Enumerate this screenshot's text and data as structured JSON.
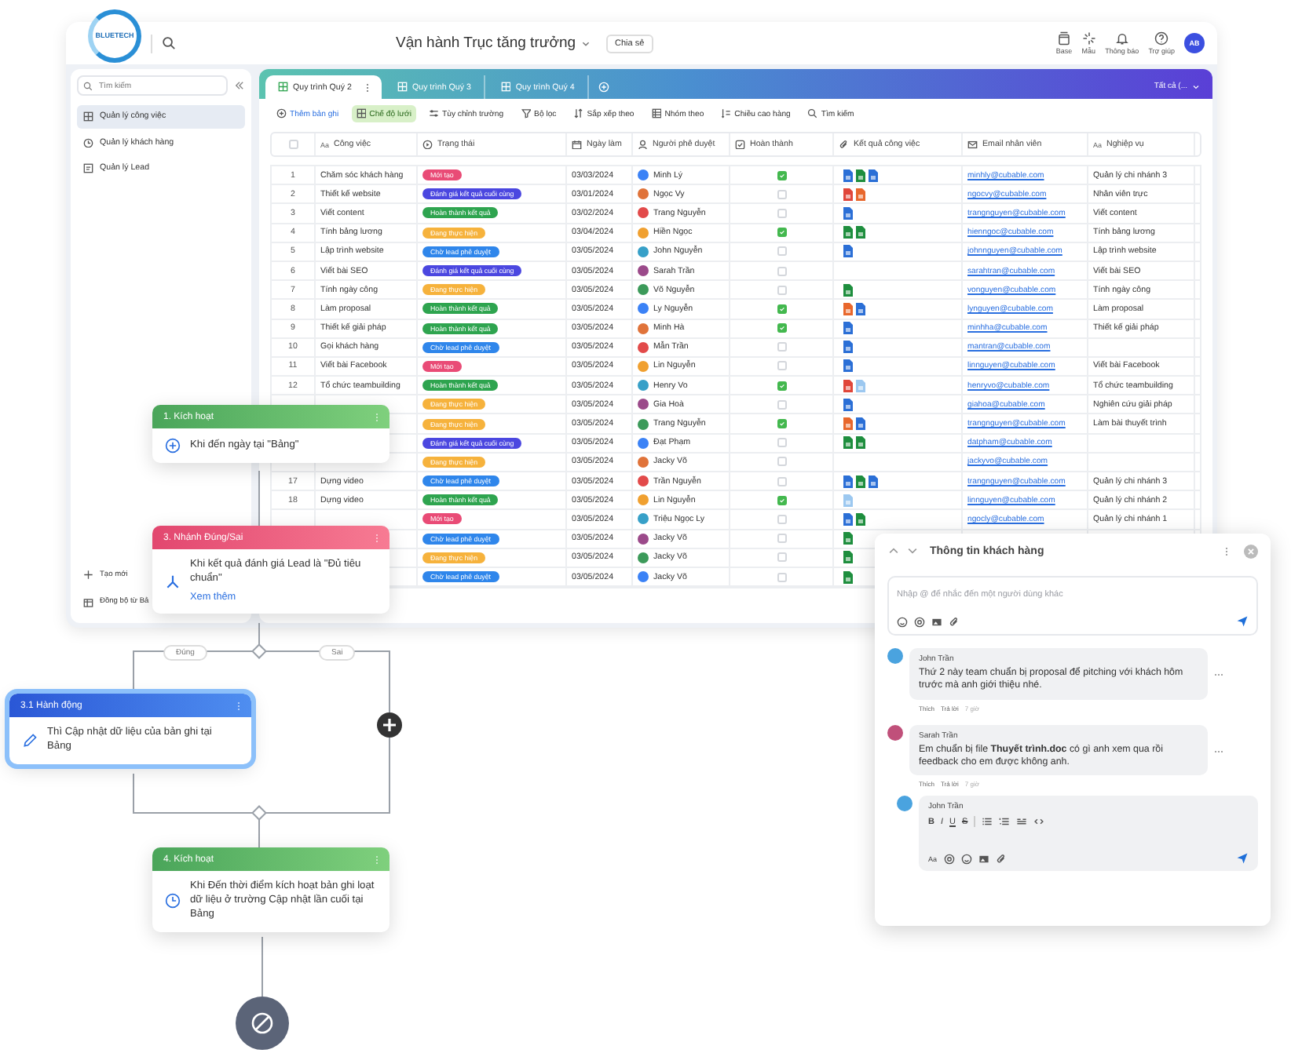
{
  "logo": {
    "text": "BLUETECH"
  },
  "header": {
    "title": "Vận hành Trục tăng trưởng",
    "share_button": "Chia sẻ",
    "actions": [
      {
        "label": "Base",
        "kind": "base"
      },
      {
        "label": "Mẫu",
        "kind": "template"
      },
      {
        "label": "Thông báo",
        "kind": "bell"
      },
      {
        "label": "Trợ giúp",
        "kind": "help"
      }
    ],
    "avatar": "AB"
  },
  "sidebar": {
    "search_placeholder": "Tìm kiếm",
    "items": [
      {
        "label": "Quản lý công việc",
        "kind": "grid",
        "selected": true
      },
      {
        "label": "Quản lý khách hàng",
        "kind": "clock",
        "selected": false
      },
      {
        "label": "Quản lý Lead",
        "kind": "form",
        "selected": false
      }
    ],
    "footer": [
      {
        "label": "Tạo mới",
        "kind": "plus"
      },
      {
        "label": "Đồng bộ từ Bả",
        "kind": "sync"
      }
    ]
  },
  "tabs": [
    {
      "label": "Quy trình Quý 2",
      "selected": true
    },
    {
      "label": "Quy trình Quý 3",
      "selected": false
    },
    {
      "label": "Quy trình Quý 4",
      "selected": false
    }
  ],
  "view_filter": "Tất cả (...",
  "toolbar": [
    {
      "label": "Thêm bản ghi",
      "kind": "add",
      "selected": false
    },
    {
      "label": "Chế độ lưới",
      "kind": "grid",
      "selected": true
    },
    {
      "label": "Tùy chỉnh trường",
      "kind": "fields",
      "selected": false
    },
    {
      "label": "Bộ lọc",
      "kind": "filter",
      "selected": false
    },
    {
      "label": "Sắp xếp theo",
      "kind": "sort",
      "selected": false
    },
    {
      "label": "Nhóm theo",
      "kind": "group",
      "selected": false
    },
    {
      "label": "Chiều cao hàng",
      "kind": "height",
      "selected": false
    },
    {
      "label": "Tìm kiếm",
      "kind": "search",
      "selected": false
    }
  ],
  "table": {
    "select_all_checked": false,
    "columns": [
      {
        "kind": "text",
        "icon_text": "Aa",
        "label": "Công việc"
      },
      {
        "kind": "status",
        "label": "Trạng thái"
      },
      {
        "kind": "date",
        "label": "Ngày làm"
      },
      {
        "kind": "person",
        "label": "Người phê duyệt"
      },
      {
        "kind": "check",
        "label": "Hoàn thành"
      },
      {
        "kind": "attach",
        "label": "Kết quả công việc"
      },
      {
        "kind": "email",
        "label": "Email nhân viên"
      },
      {
        "kind": "text",
        "icon_text": "Aa",
        "label": "Nghiệp vụ"
      }
    ],
    "rows": [
      {
        "number": "1",
        "task": "Chăm sóc khách hàng",
        "status": {
          "label": "Mới tạo",
          "color": "#e94b76"
        },
        "date": "03/03/2024",
        "approver": "Minh Lý",
        "done": true,
        "files": [
          {
            "kind": "doc"
          },
          {
            "kind": "sheet"
          },
          {
            "kind": "doc"
          }
        ],
        "email": "minhly@cubable.com",
        "role": "Quản lý chi nhánh 3"
      },
      {
        "number": "2",
        "task": "Thiết kế website",
        "status": {
          "label": "Đánh giá kết quả cuối cùng",
          "color": "#4b47e0"
        },
        "date": "03/01/2024",
        "approver": "Ngọc Vy",
        "done": false,
        "files": [
          {
            "kind": "pdf"
          },
          {
            "kind": "ppt"
          }
        ],
        "email": "ngocvy@cubable.com",
        "role": "Nhân viên trực"
      },
      {
        "number": "3",
        "task": "Viết content",
        "status": {
          "label": "Hoàn thành kết quả",
          "color": "#2ea44f"
        },
        "date": "03/02/2024",
        "approver": "Trang Nguyễn",
        "done": false,
        "files": [
          {
            "kind": "doc"
          }
        ],
        "email": "trangnguyen@cubable.com",
        "role": "Viết content"
      },
      {
        "number": "4",
        "task": "Tính bảng lương",
        "status": {
          "label": "Đang thực hiện",
          "color": "#f6b23c"
        },
        "date": "03/04/2024",
        "approver": "Hiền Ngọc",
        "done": true,
        "files": [
          {
            "kind": "sheet"
          },
          {
            "kind": "sheet"
          }
        ],
        "email": "hienngoc@cubable.com",
        "role": "Tính bảng lương"
      },
      {
        "number": "5",
        "task": "Lập trình website",
        "status": {
          "label": "Chờ lead phê duyệt",
          "color": "#2f86eb"
        },
        "date": "03/05/2024",
        "approver": "John Nguyễn",
        "done": false,
        "files": [
          {
            "kind": "doc"
          }
        ],
        "email": "johnnguyen@cubable.com",
        "role": "Lập trình website"
      },
      {
        "number": "6",
        "task": "Viết bài SEO",
        "status": {
          "label": "Đánh giá kết quả cuối cùng",
          "color": "#4b47e0"
        },
        "date": "03/05/2024",
        "approver": "Sarah Trần",
        "done": false,
        "files": [],
        "email": "sarahtran@cubable.com",
        "role": "Viết bài SEO"
      },
      {
        "number": "7",
        "task": "Tính ngày công",
        "status": {
          "label": "Đang thực hiện",
          "color": "#f6b23c"
        },
        "date": "03/05/2024",
        "approver": "Võ Nguyễn",
        "done": false,
        "files": [
          {
            "kind": "sheet"
          }
        ],
        "email": "vonguyen@cubable.com",
        "role": "Tính ngày công"
      },
      {
        "number": "8",
        "task": "Làm proposal",
        "status": {
          "label": "Hoàn thành kết quả",
          "color": "#2ea44f"
        },
        "date": "03/05/2024",
        "approver": "Ly Nguyễn",
        "done": true,
        "files": [
          {
            "kind": "ppt"
          },
          {
            "kind": "doc"
          }
        ],
        "email": "lynguyen@cubable.com",
        "role": "Làm proposal"
      },
      {
        "number": "9",
        "task": "Thiết kế giải pháp",
        "status": {
          "label": "Hoàn thành kết quả",
          "color": "#2ea44f"
        },
        "date": "03/05/2024",
        "approver": "Minh Hà",
        "done": true,
        "files": [
          {
            "kind": "doc"
          }
        ],
        "email": "minhha@cubable.com",
        "role": "Thiết kế giải pháp"
      },
      {
        "number": "10",
        "task": "Gọi khách hàng",
        "status": {
          "label": "Chờ lead phê duyệt",
          "color": "#2f86eb"
        },
        "date": "03/05/2024",
        "approver": "Mẫn Trần",
        "done": false,
        "files": [
          {
            "kind": "doc"
          }
        ],
        "email": "mantran@cubable.com"
      },
      {
        "number": "11",
        "task": "Viết bài Facebook",
        "status": {
          "label": "Mới tạo",
          "color": "#e94b76"
        },
        "date": "03/05/2024",
        "approver": "Lin Nguyễn",
        "done": false,
        "files": [
          {
            "kind": "doc"
          }
        ],
        "email": "linnguyen@cubable.com",
        "role": "Viết bài Facebook"
      },
      {
        "number": "12",
        "task": "Tổ chức teambuilding",
        "status": {
          "label": "Hoàn thành kết quả",
          "color": "#2ea44f"
        },
        "date": "03/05/2024",
        "approver": "Henry Vo",
        "done": true,
        "files": [
          {
            "kind": "pdf"
          },
          {
            "kind": "image"
          }
        ],
        "email": "henryvo@cubable.com",
        "role": "Tổ chức teambuilding"
      },
      {
        "status": {
          "label": "Đang thực hiện",
          "color": "#f6b23c"
        },
        "date": "03/05/2024",
        "approver": "Gia Hoà",
        "done": false,
        "files": [
          {
            "kind": "doc"
          }
        ],
        "email": "giahoa@cubable.com",
        "role": "Nghiên cứu giải pháp"
      },
      {
        "status": {
          "label": "Đang thực hiện",
          "color": "#f6b23c"
        },
        "date": "03/05/2024",
        "approver": "Trang Nguyễn",
        "done": true,
        "files": [
          {
            "kind": "ppt"
          },
          {
            "kind": "doc"
          }
        ],
        "email": "trangnguyen@cubable.com",
        "role": "Làm bài thuyết trình"
      },
      {
        "status": {
          "label": "Đánh giá kết quả cuối cùng",
          "color": "#4b47e0"
        },
        "date": "03/05/2024",
        "approver": "Đạt Phạm",
        "done": false,
        "files": [
          {
            "kind": "sheet"
          },
          {
            "kind": "sheet"
          }
        ],
        "email": "datpham@cubable.com"
      },
      {
        "status": {
          "label": "Đang thực hiện",
          "color": "#f6b23c"
        },
        "date": "03/05/2024",
        "approver": "Jacky Võ",
        "done": false,
        "files": [],
        "email": "jackyvo@cubable.com"
      },
      {
        "number": "17",
        "task": "Dựng video",
        "status": {
          "label": "Chờ lead phê duyệt",
          "color": "#2f86eb"
        },
        "date": "03/05/2024",
        "approver": "Trần Nguyễn",
        "done": false,
        "files": [
          {
            "kind": "doc"
          },
          {
            "kind": "sheet"
          },
          {
            "kind": "doc"
          }
        ],
        "email": "trangnguyen@cubable.com",
        "role": "Quản lý chi nhánh 3"
      },
      {
        "number": "18",
        "task": "Dựng video",
        "status": {
          "label": "Hoàn thành kết quả",
          "color": "#2ea44f"
        },
        "date": "03/05/2024",
        "approver": "Lin Nguyễn",
        "done": true,
        "files": [
          {
            "kind": "image"
          }
        ],
        "email": "linnguyen@cubable.com",
        "role": "Quản lý chi nhánh 2"
      },
      {
        "status": {
          "label": "Mới tạo",
          "color": "#e94b76"
        },
        "date": "03/05/2024",
        "approver": "Triệu Ngọc Ly",
        "done": false,
        "files": [
          {
            "kind": "doc"
          },
          {
            "kind": "sheet"
          }
        ],
        "email": "ngocly@cubable.com",
        "role": "Quản lý chi nhánh 1"
      },
      {
        "status": {
          "label": "Chờ lead phê duyệt",
          "color": "#2f86eb"
        },
        "date": "03/05/2024",
        "approver": "Jacky Võ",
        "done": false,
        "files": [
          {
            "kind": "sheet"
          }
        ]
      },
      {
        "status": {
          "label": "Đang thực hiện",
          "color": "#f6b23c"
        },
        "date": "03/05/2024",
        "approver": "Jacky Võ",
        "done": false,
        "files": [
          {
            "kind": "sheet"
          }
        ]
      },
      {
        "status": {
          "label": "Chờ lead phê duyệt",
          "color": "#2f86eb"
        },
        "date": "03/05/2024",
        "approver": "Jacky Võ",
        "done": false,
        "files": [
          {
            "kind": "sheet"
          }
        ]
      }
    ]
  },
  "flow": {
    "nodes": [
      {
        "kind": "trigger",
        "title": "1. Kích hoạt",
        "text": "Khi đến ngày tại \"Bảng\"",
        "selected": false
      },
      {
        "kind": "branch",
        "title": "3. Nhánh Đúng/Sai",
        "text": "Khi kết quả đánh giá Lead là \"Đủ tiêu chuẩn\"",
        "link": "Xem thêm",
        "selected": false
      },
      {
        "kind": "action",
        "title": "3.1 Hành động",
        "text": "Thì Cập nhật dữ liệu của bản ghi tại Bảng",
        "selected": true
      },
      {
        "kind": "trigger",
        "title": "4. Kích hoạt",
        "text": "Khi Đến thời điểm kích hoạt bản ghi loạt dữ liệu ở trường Cập nhật lần cuối tại Bảng",
        "selected": false
      }
    ],
    "branch_labels": [
      "Đúng",
      "Sai"
    ]
  },
  "comment_panel": {
    "title": "Thông tin khách hàng",
    "placeholder": "Nhập @ để nhắc đến một người dùng khác",
    "comments": [
      {
        "author": "John Trần",
        "text": "Thứ 2 này team chuẩn bị proposal để pitching với khách hôm trước mà anh giới thiệu nhé.",
        "like": "Thích",
        "reply": "Trả lời",
        "time": "7 giờ"
      },
      {
        "author": "Sarah Trần",
        "text": "Em chuẩn bị file **Thuyết trình.doc** có gì anh xem qua rồi feedback cho em được không anh.",
        "like": "Thích",
        "reply": "Trả lời",
        "time": "7 giờ"
      }
    ],
    "reply_box": {
      "author": "John Trần",
      "format_buttons": [
        "B",
        "I",
        "U",
        "S"
      ],
      "font_button": "Aa"
    }
  }
}
